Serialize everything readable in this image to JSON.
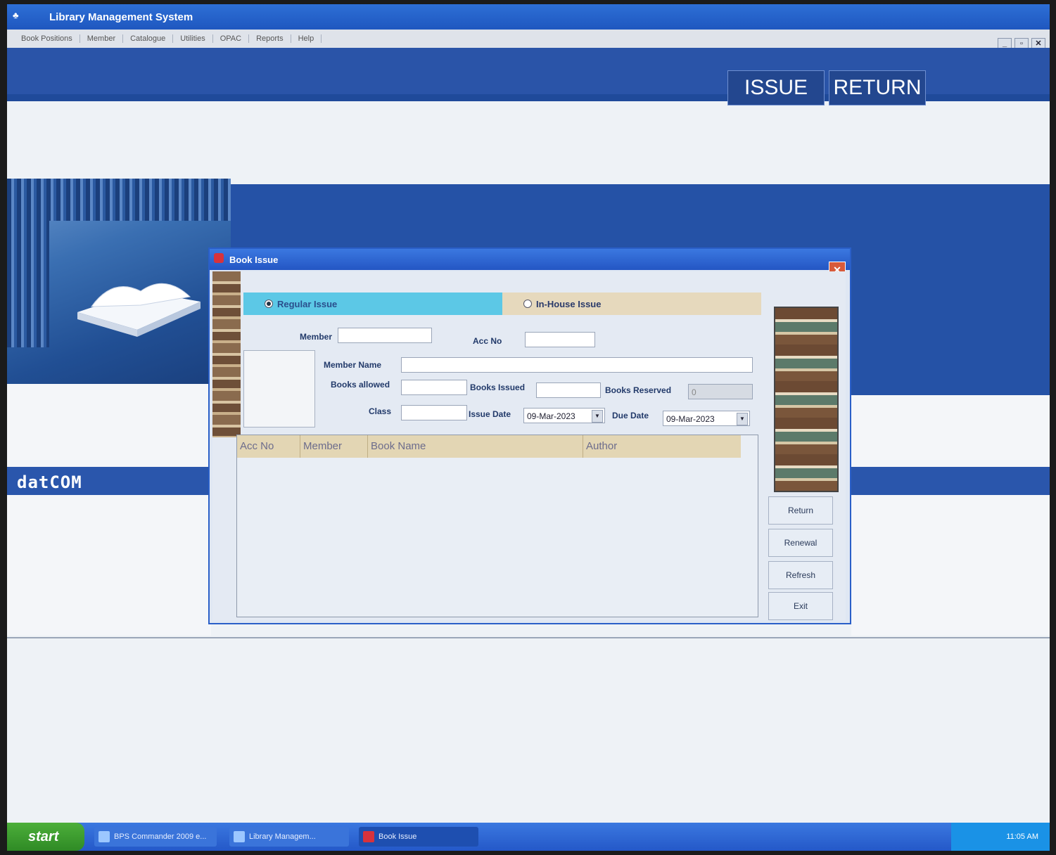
{
  "window": {
    "title": "Library Management System"
  },
  "menu": {
    "items": [
      "Book Positions",
      "Member",
      "Catalogue",
      "Utilities",
      "OPAC",
      "Reports",
      "Help"
    ]
  },
  "toolbar": {
    "issue_label": "ISSUE",
    "return_label": "RETURN"
  },
  "brand": {
    "logo_text": "datCOM"
  },
  "dialog": {
    "title": "Book Issue",
    "close_label": "✕",
    "issue_type": {
      "regular_label": "Regular Issue",
      "inhouse_label": "In-House Issue",
      "selected": "Regular Issue"
    },
    "fields": {
      "member_label": "Member",
      "member_value": "",
      "acc_no_label": "Acc No",
      "acc_no_value": "",
      "member_name_label": "Member Name",
      "member_name_value": "",
      "books_allowed_label": "Books allowed",
      "books_allowed_value": "",
      "books_issued_label": "Books Issued",
      "books_issued_value": "",
      "books_reserved_label": "Books Reserved",
      "books_reserved_value": "0",
      "class_label": "Class",
      "class_value": "",
      "issue_date_label": "Issue Date",
      "issue_date_value": "09-Mar-2023",
      "due_date_label": "Due Date",
      "due_date_value": "09-Mar-2023"
    },
    "grid": {
      "columns": [
        "Acc No",
        "Member",
        "Book Name",
        "Author"
      ],
      "rows": []
    },
    "buttons": {
      "return": "Return",
      "renewal": "Renewal",
      "refresh": "Refresh",
      "exit": "Exit"
    }
  },
  "taskbar": {
    "start_label": "start",
    "items": [
      "BPS Commander 2009 e...",
      "Library Managem...",
      "Book Issue"
    ],
    "clock": "11:05 AM"
  }
}
